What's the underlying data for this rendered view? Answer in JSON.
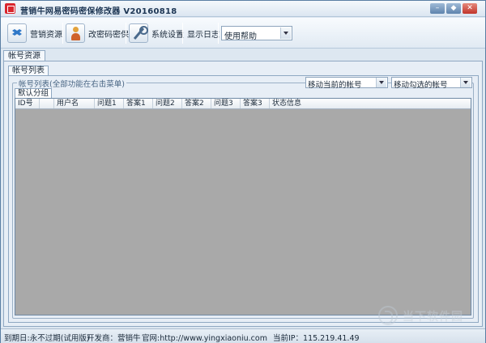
{
  "window": {
    "title": "营销牛网易密码密保修改器 V20160818",
    "controls": [
      "minimize-icon",
      "maximize-icon",
      "close-icon"
    ]
  },
  "toolbar": {
    "buttons": [
      {
        "label": "营销资源",
        "icon": "dropbox-icon"
      },
      {
        "label": "改密码密保",
        "icon": "user-icon"
      },
      {
        "label": "系统设置",
        "icon": "wrench-icon"
      },
      {
        "label": "显示日志"
      }
    ],
    "help_select": {
      "value": "使用帮助"
    }
  },
  "tabs": {
    "outer": "帐号资源",
    "inner": "帐号列表"
  },
  "account_panel": {
    "group_title": "帐号列表(全部功能在右击菜单)",
    "move_current": "移动当前的帐号",
    "move_checked": "移动勾选的帐号",
    "group_tab": "默认分组",
    "columns": [
      "ID号",
      "",
      "用户名",
      "问题1",
      "答案1",
      "问题2",
      "答案2",
      "问题3",
      "答案3",
      "状态信息"
    ],
    "rows": []
  },
  "statusbar": {
    "expiry": "到期日:永不过期(试用版)",
    "developer": "开发商：营销牛",
    "website": "官网:http://www.yingxiaoniu.com",
    "ip": "当前IP：115.219.41.49"
  },
  "colors": {
    "grid_background": "#a9a9a9",
    "close_button": "#c1342a",
    "window_border": "#5a7ea3"
  }
}
